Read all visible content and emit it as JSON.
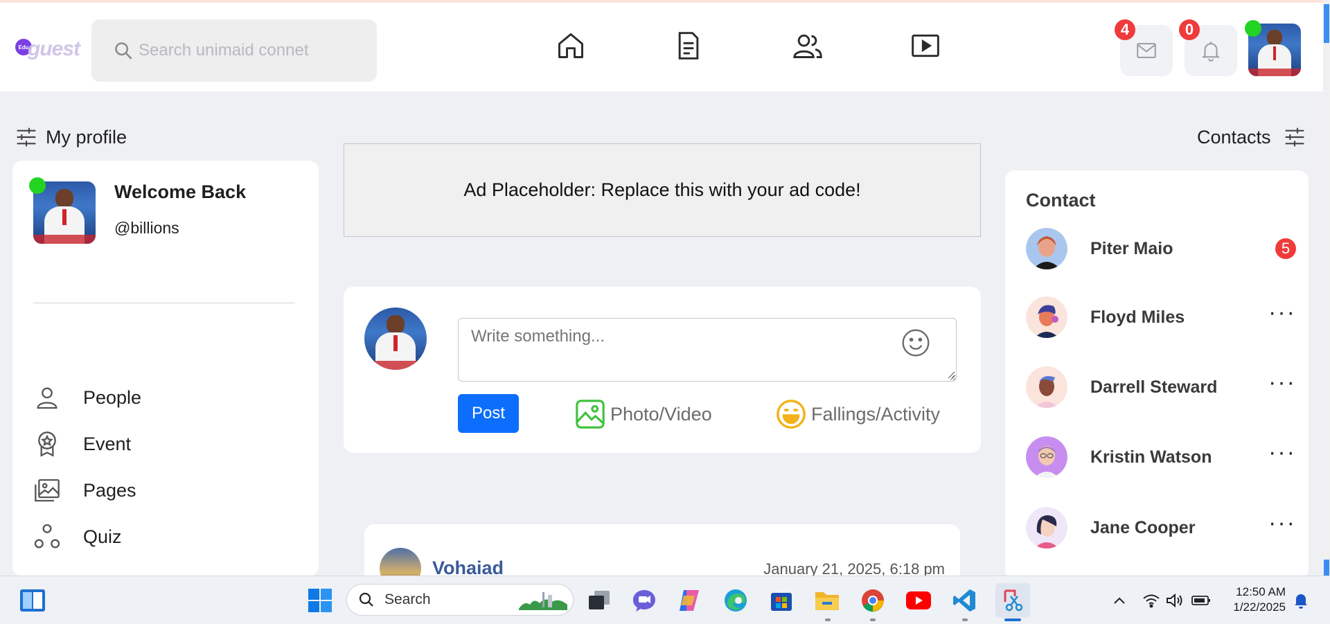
{
  "header": {
    "logo_text": "guest",
    "logo_badge": "Edu",
    "search_placeholder": "Search unimaid connet",
    "nav": [
      "home-icon",
      "document-icon",
      "people-icon",
      "video-icon"
    ],
    "messages_count": "4",
    "notifications_count": "0"
  },
  "left": {
    "title": "My profile",
    "welcome": "Welcome Back",
    "handle": "@billions",
    "menu": [
      {
        "label": "People",
        "icon": "person-icon"
      },
      {
        "label": "Event",
        "icon": "award-icon"
      },
      {
        "label": "Pages",
        "icon": "images-icon"
      },
      {
        "label": "Quiz",
        "icon": "quiz-icon"
      }
    ]
  },
  "center": {
    "ad_text": "Ad Placeholder: Replace this with your ad code!",
    "composer_placeholder": "Write something...",
    "post_label": "Post",
    "photo_label": "Photo/Video",
    "feeling_label": "Fallings/Activity",
    "feed": {
      "name": "Vohaiad",
      "date": "January 21, 2025, 6:18 pm"
    }
  },
  "right": {
    "title": "Contacts",
    "card_title": "Contact",
    "contacts": [
      {
        "name": "Piter Maio",
        "badge": "5"
      },
      {
        "name": "Floyd Miles",
        "more": "···"
      },
      {
        "name": "Darrell Steward",
        "more": "···"
      },
      {
        "name": "Kristin Watson",
        "more": "···"
      },
      {
        "name": "Jane Cooper",
        "more": "···"
      }
    ]
  },
  "taskbar": {
    "search_label": "Search",
    "time": "12:50 AM",
    "date": "1/22/2025"
  },
  "colors": {
    "primary": "#0d6efd",
    "badge": "#ef3b3b",
    "online": "#22d322",
    "background": "#eef0f4"
  }
}
